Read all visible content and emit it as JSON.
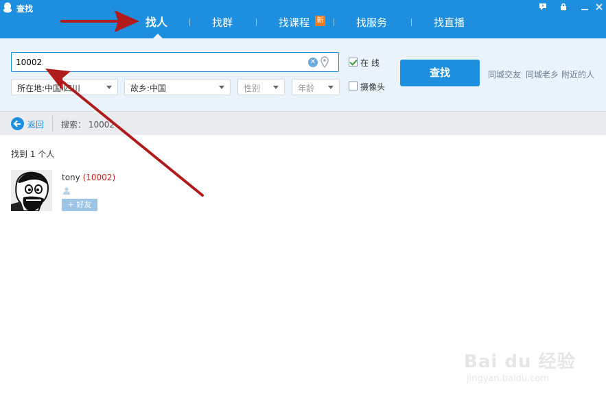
{
  "window": {
    "title": "查找",
    "controls": [
      "feedback-icon",
      "lock-icon",
      "minimize-icon",
      "close-icon"
    ]
  },
  "tabs": [
    {
      "label": "找人",
      "active": true
    },
    {
      "label": "找群",
      "active": false
    },
    {
      "label": "找课程",
      "active": false,
      "badge": "新"
    },
    {
      "label": "找服务",
      "active": false
    },
    {
      "label": "找直播",
      "active": false
    }
  ],
  "search": {
    "value": "10002",
    "location_select": "所在地:中国 四川",
    "hometown_select": "故乡:中国",
    "gender_select": "性别",
    "age_select": "年龄",
    "online_label": "在 线",
    "online_checked": true,
    "camera_label": "摄像头",
    "camera_checked": false,
    "find_button": "查找",
    "quick_links": [
      "同城交友",
      "同城老乡",
      "附近的人"
    ]
  },
  "breadcrumb": {
    "back_label": "返回",
    "summary": "搜索： 10002"
  },
  "results": {
    "count_text": "找到 1 个人",
    "items": [
      {
        "name": "tony",
        "id": "(10002)",
        "add_button": "+ 好友"
      }
    ]
  },
  "watermark": {
    "brand": "Bai du 经验",
    "url": "jingyan.baidu.com"
  },
  "colors": {
    "primary": "#1e8fdf",
    "panel_bg": "#eaf3fb",
    "badge": "#f37b1d",
    "id_red": "#d01f1f",
    "annotation_arrow": "#b01c1c"
  }
}
